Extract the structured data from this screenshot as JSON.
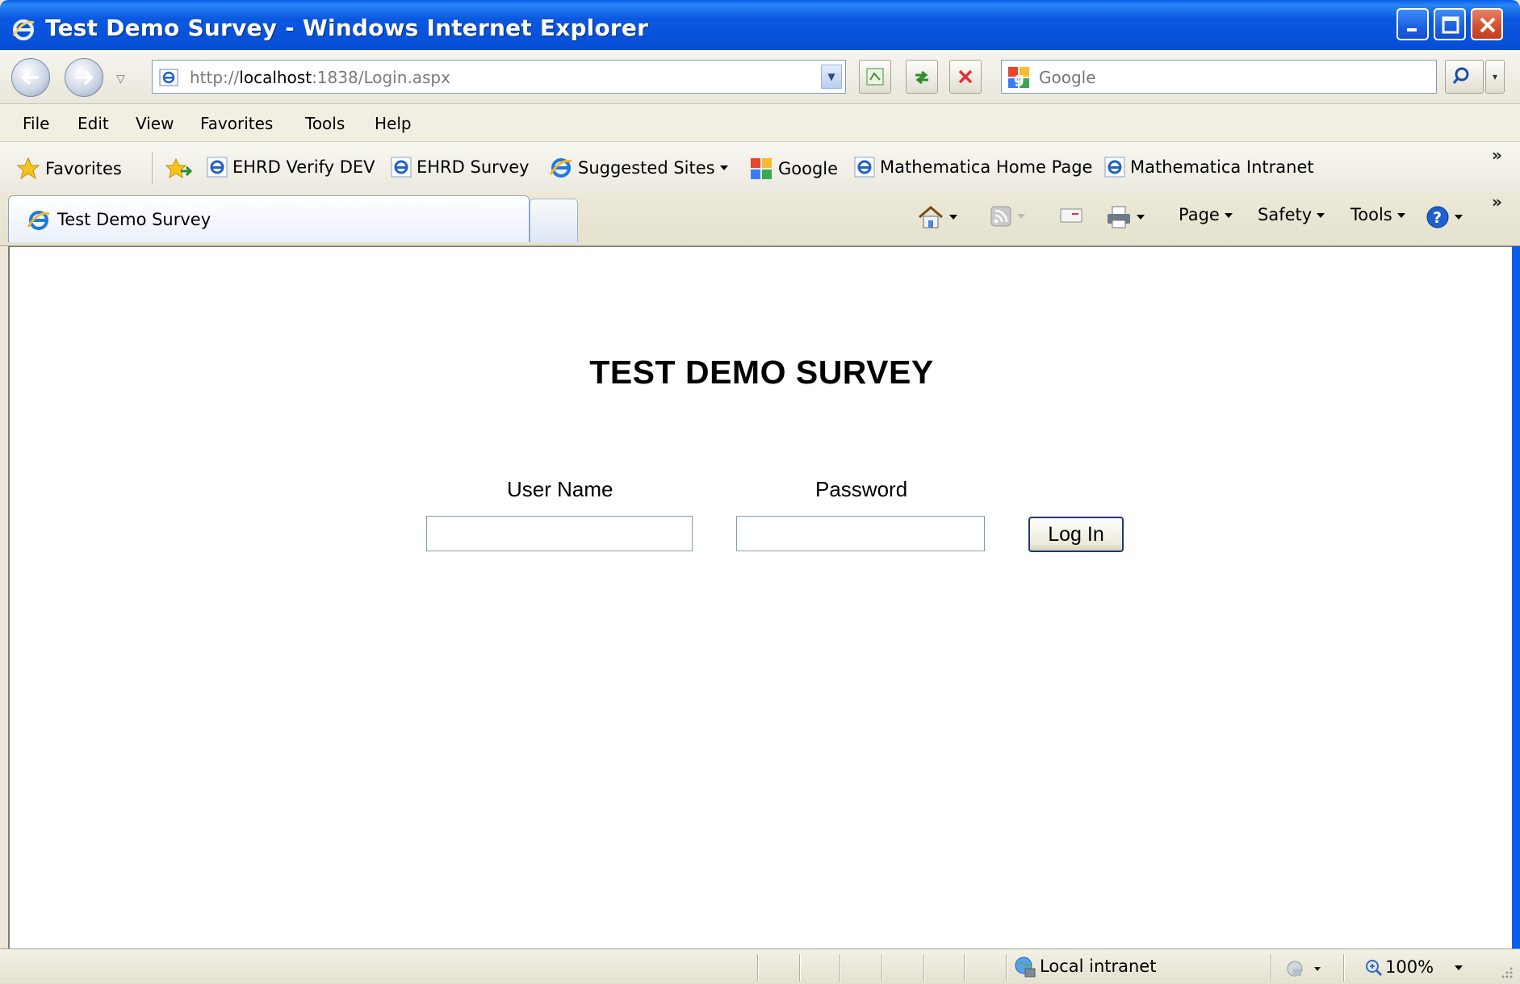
{
  "window": {
    "title": "Test Demo Survey - Windows Internet Explorer",
    "buttons": {
      "minimize": "minimize-icon",
      "maximize": "maximize-icon",
      "close": "close-icon"
    }
  },
  "address_bar": {
    "url_prefix": "http://",
    "url_host": "localhost",
    "url_rest": ":1838/Login.aspx",
    "search_placeholder": "Google"
  },
  "menu": [
    "File",
    "Edit",
    "View",
    "Favorites",
    "Tools",
    "Help"
  ],
  "favorites_bar": {
    "favorites_label": "Favorites",
    "links": [
      "EHRD Verify DEV",
      "EHRD Survey",
      "Suggested Sites",
      "Google",
      "Mathematica Home Page",
      "Mathematica Intranet"
    ]
  },
  "tabs": [
    {
      "label": "Test Demo Survey"
    }
  ],
  "command_bar": {
    "page": "Page",
    "safety": "Safety",
    "tools": "Tools"
  },
  "page": {
    "heading": "TEST DEMO SURVEY",
    "username_label": "User Name",
    "password_label": "Password",
    "username_value": "",
    "password_value": "",
    "login_button": "Log In"
  },
  "status_bar": {
    "zone": "Local intranet",
    "zoom": "100%"
  },
  "colors": {
    "titlebar": "#0750d8",
    "content_bg": "#ffffff",
    "chrome_bg": "#ece9d8"
  }
}
